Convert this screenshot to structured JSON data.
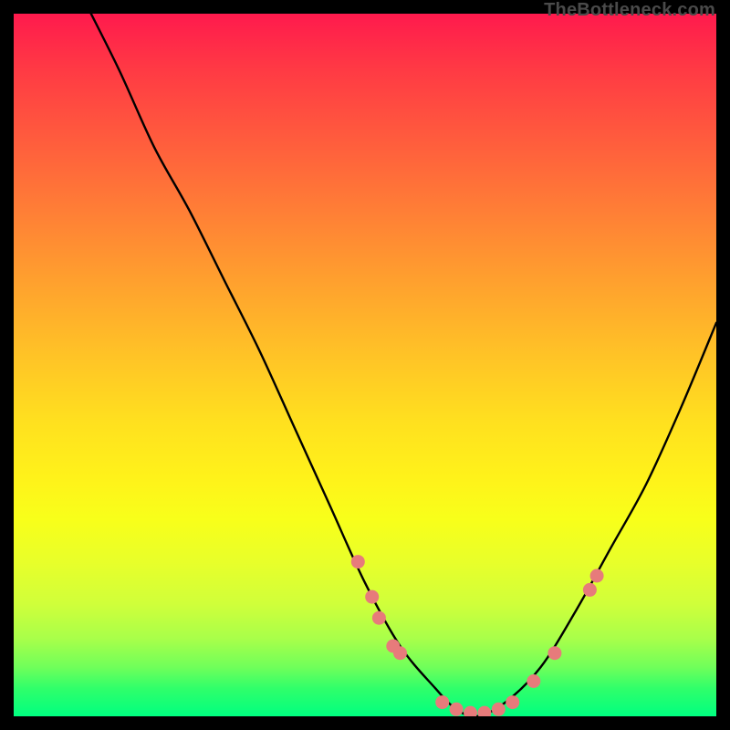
{
  "attribution": "TheBottleneck.com",
  "palette": {
    "curve_stroke": "#000000",
    "dot_fill": "#e77b7b",
    "dot_stroke": "#d86a6a"
  },
  "chart_data": {
    "type": "line",
    "title": "",
    "xlabel": "",
    "ylabel": "",
    "xlim": [
      0,
      100
    ],
    "ylim": [
      0,
      100
    ],
    "grid": false,
    "series": [
      {
        "name": "bottleneck-curve",
        "x": [
          0,
          5,
          10,
          15,
          20,
          25,
          30,
          35,
          40,
          45,
          50,
          55,
          60,
          63,
          66,
          70,
          75,
          80,
          85,
          90,
          95,
          100
        ],
        "values": [
          122,
          112,
          102,
          92,
          81,
          72,
          62,
          52,
          41,
          30,
          19,
          10,
          4,
          1,
          0,
          2,
          7,
          15,
          24,
          33,
          44,
          56
        ]
      }
    ],
    "scatter": {
      "name": "highlighted-points",
      "points": [
        {
          "x": 49,
          "y": 22
        },
        {
          "x": 51,
          "y": 17
        },
        {
          "x": 52,
          "y": 14
        },
        {
          "x": 54,
          "y": 10
        },
        {
          "x": 55,
          "y": 9
        },
        {
          "x": 61,
          "y": 2
        },
        {
          "x": 63,
          "y": 1
        },
        {
          "x": 65,
          "y": 0.5
        },
        {
          "x": 67,
          "y": 0.5
        },
        {
          "x": 69,
          "y": 1
        },
        {
          "x": 71,
          "y": 2
        },
        {
          "x": 74,
          "y": 5
        },
        {
          "x": 77,
          "y": 9
        },
        {
          "x": 82,
          "y": 18
        },
        {
          "x": 83,
          "y": 20
        }
      ]
    }
  }
}
